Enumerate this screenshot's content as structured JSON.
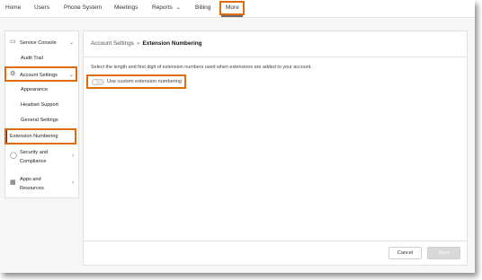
{
  "nav": {
    "items": [
      {
        "label": "Home"
      },
      {
        "label": "Users"
      },
      {
        "label": "Phone System"
      },
      {
        "label": "Meetings"
      },
      {
        "label": "Reports"
      },
      {
        "label": "Billing"
      },
      {
        "label": "More"
      }
    ],
    "reports_chevron": "chevron-down-icon",
    "highlight_color": "#e06b0c"
  },
  "sidebar": {
    "service_console": {
      "label": "Service Console",
      "icon": "monitor-icon"
    },
    "audit_trail": "Audit Trail",
    "account_settings": {
      "label": "Account Settings",
      "icon": "gear-icon"
    },
    "appearance": "Appearance",
    "headset_support": "Headset Support",
    "general_settings": "General Settings",
    "extension_numbering": "Extension Numbering",
    "security": {
      "label_line1": "Security and",
      "label_line2": "Compliance",
      "icon": "shield-icon"
    },
    "apps": {
      "label_line1": "Apps and",
      "label_line2": "Resources",
      "icon": "grid-icon"
    }
  },
  "main": {
    "breadcrumb_parent": "Account Settings",
    "breadcrumb_sep": "»",
    "breadcrumb_current": "Extension Numbering",
    "description": "Select the length and first digit of extension numbers used when extensions are added to your account.",
    "toggle_label": "Use custom extension numbering",
    "toggle_on": false,
    "cancel_label": "Cancel",
    "save_label": "Save"
  }
}
